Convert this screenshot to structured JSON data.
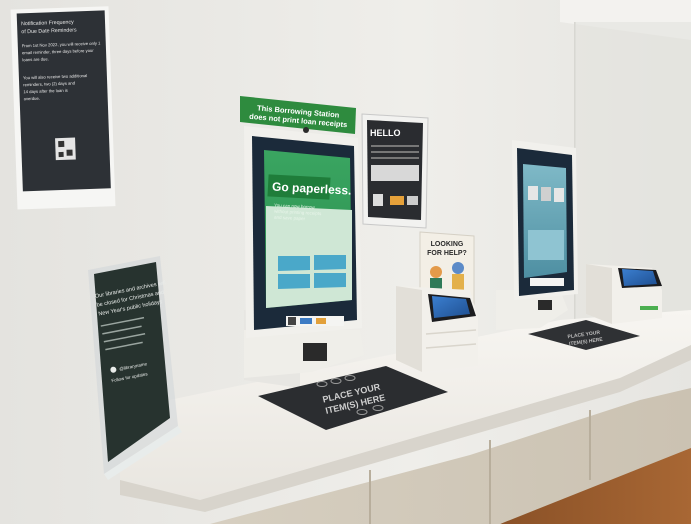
{
  "left_poster": {
    "lines": [
      "Notification Frequency",
      "of Due Date Reminders",
      "From 1st Nov 2022, you will receive only 1",
      "email reminder, three days before your",
      "loans are due.",
      "You will also receive two additional",
      "reminders, two (2) days and",
      "14 days after the loan is",
      "overdue."
    ]
  },
  "kiosk_sign": {
    "line1": "This Borrowing Station",
    "line2": "does not print loan receipts"
  },
  "screen": {
    "headline": "Go paperless.",
    "caption_lines": [
      "You can now borrow",
      "without printing receipts",
      "and save paper"
    ]
  },
  "hello_poster": {
    "title": "HELLO"
  },
  "help_card": {
    "line1": "LOOKING",
    "line2": "FOR HELP?"
  },
  "closure_sign": {
    "line1": "Our libraries and archives will",
    "line2": "be closed for Christmas and",
    "line3": "New Year's public holidays",
    "handle": "@libraryname",
    "follow": "Follow for updates"
  },
  "mat_front": {
    "line1": "PLACE YOUR",
    "line2": "ITEM(S) HERE"
  },
  "mat_back": {
    "line1": "PLACE YOUR",
    "line2": "ITEM(S) HERE"
  },
  "colors": {
    "wall": "#ecebe7",
    "counter": "#f4f2ee",
    "kiosk_body": "#f1f0ec",
    "screen_bezel": "#1b2a3a",
    "screen_bg": "#2f9b57",
    "green_sign": "#2e8b3e",
    "mat": "#2b2d30",
    "floor": "#9a5b2e"
  }
}
